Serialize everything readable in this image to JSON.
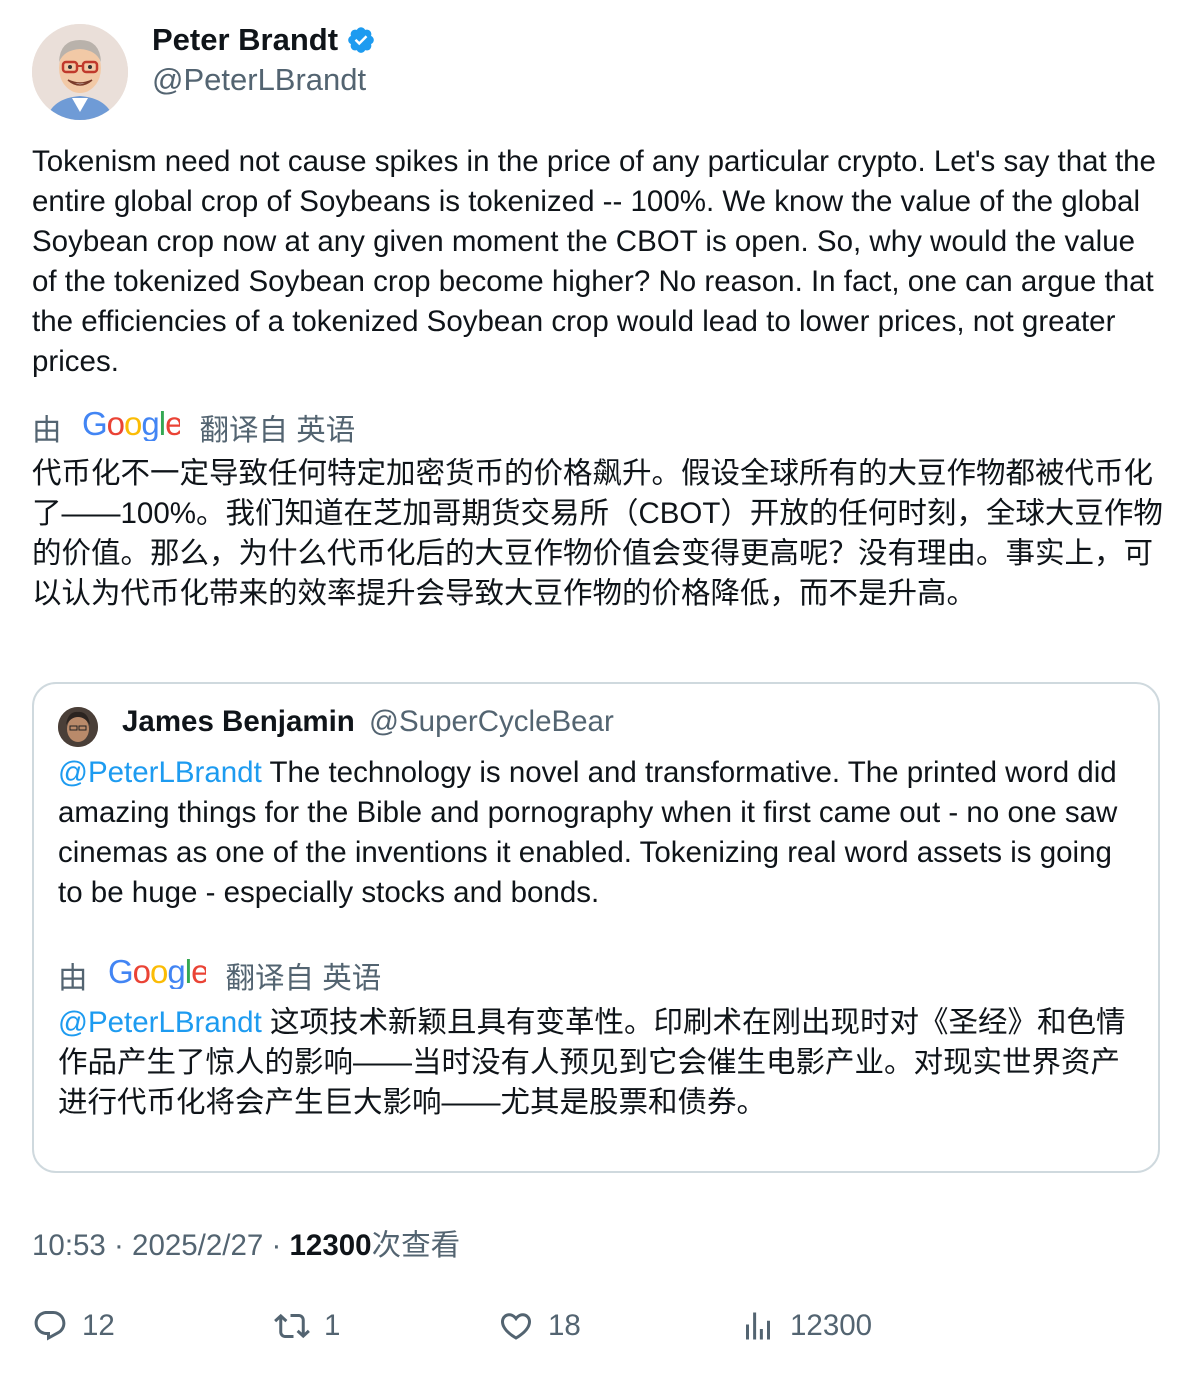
{
  "author": {
    "name": "Peter Brandt",
    "handle": "@PeterLBrandt",
    "verified_icon": "verified-badge-icon",
    "verified_color": "#1d9bf0"
  },
  "tweet": {
    "text": "Tokenism need not cause spikes in the price of any particular crypto. Let's say that the entire global crop of Soybeans is tokenized -- 100%. We know the value of the global Soybean crop now at any given moment the CBOT is open. So, why would the value of the tokenized Soybean crop become higher? No reason. In fact, one can argue that the efficiencies of a tokenized Soybean crop would lead to lower prices, not greater prices.",
    "translated_text": "代币化不一定导致任何特定加密货币的价格飙升。假设全球所有的大豆作物都被代币化了——100%。我们知道在芝加哥期货交易所（CBOT）开放的任何时刻，全球大豆作物的价值。那么，为什么代币化后的大豆作物价值会变得更高呢？没有理由。事实上，可以认为代币化带来的效率提升会导致大豆作物的价格降低，而不是升高。"
  },
  "translation": {
    "by_label": "由",
    "provider": "Google",
    "from_label": "翻译自 英语"
  },
  "quote": {
    "name": "James Benjamin",
    "handle": "@SuperCycleBear",
    "mention": "@PeterLBrandt",
    "text": " The technology is novel and transformative. The printed word did amazing things for the Bible and pornography when it first came out - no one saw cinemas as one of the inventions it enabled. Tokenizing real word assets is going to be huge - especially stocks and bonds.",
    "translated_text": " 这项技术新颖且具有变革性。印刷术在刚出现时对《圣经》和色情作品产生了惊人的影响——当时没有人预见到它会催生电影产业。对现实世界资产进行代币化将会产生巨大影响——尤其是股票和债券。"
  },
  "meta": {
    "time": "10:53",
    "separator": " · ",
    "date": "2025/2/27",
    "views_count": "12300",
    "views_label": "次查看"
  },
  "actions": {
    "replies": "12",
    "retweets": "1",
    "likes": "18",
    "views": "12300"
  },
  "colors": {
    "text": "#0f1419",
    "secondary": "#536471",
    "link": "#1d9bf0",
    "border": "#cfd9de"
  }
}
